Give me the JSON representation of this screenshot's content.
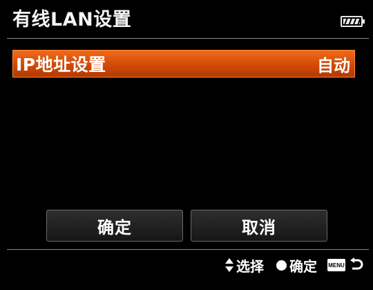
{
  "header": {
    "title": "有线LAN设置",
    "battery_icon": "battery-full-icon"
  },
  "menu": {
    "items": [
      {
        "label": "IP地址设置",
        "value": "自动",
        "selected": true
      }
    ]
  },
  "buttons": {
    "ok_label": "确定",
    "cancel_label": "取消"
  },
  "footer": {
    "select_label": "选择",
    "select_icon": "up-down-arrow-icon",
    "confirm_label": "确定",
    "confirm_icon": "center-button-dot-icon",
    "menu_key_label": "MENU",
    "back_icon": "return-arrow-icon"
  },
  "colors": {
    "background": "#000000",
    "highlight": "#d9520d",
    "highlight_border": "#ff8a3a",
    "text": "#ffffff",
    "divider": "#8a8a8a"
  }
}
